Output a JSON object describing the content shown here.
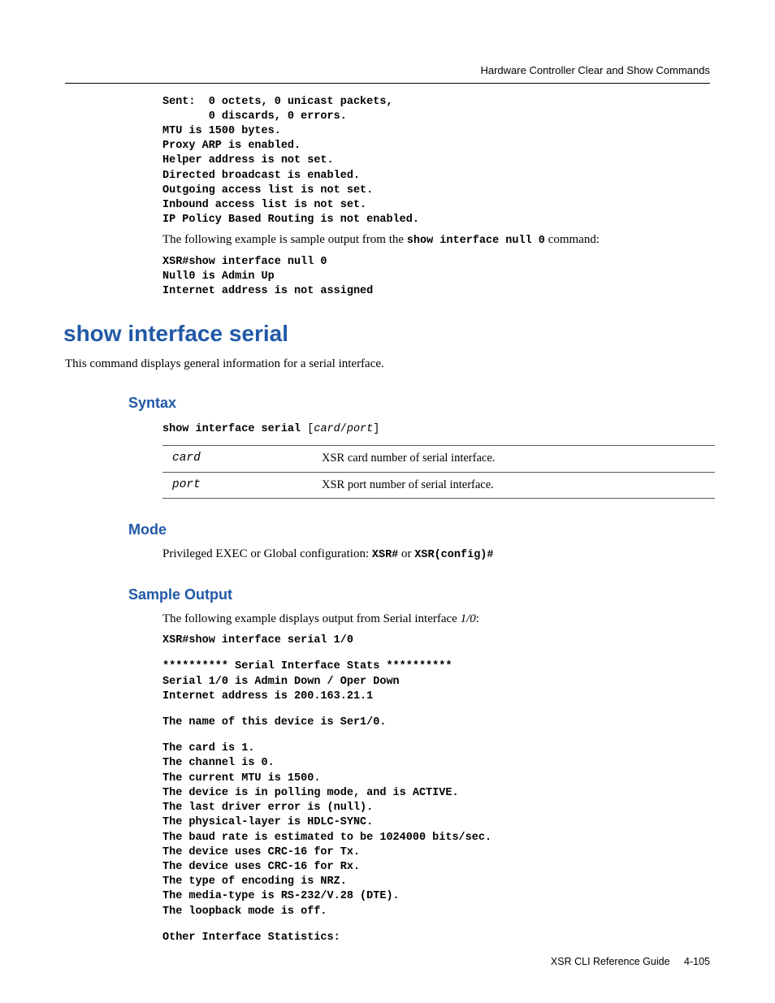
{
  "running_head": "Hardware Controller Clear and Show Commands",
  "top_block": {
    "lines": "Sent:  0 octets, 0 unicast packets,\n       0 discards, 0 errors.\nMTU is 1500 bytes.\nProxy ARP is enabled.\nHelper address is not set.\nDirected broadcast is enabled.\nOutgoing access list is not set.\nInbound access list is not set.\nIP Policy Based Routing is not enabled.",
    "para_lead": "The following example is sample output from the ",
    "para_cmd": "show interface null 0",
    "para_tail": " command:",
    "lines2": "XSR#show interface null 0\nNull0 is Admin Up\nInternet address is not assigned"
  },
  "h1": "show interface serial",
  "h1_desc": "This command displays general information for a serial interface.",
  "syntax": {
    "heading": "Syntax",
    "cmd": "show interface serial ",
    "bracket_open": "[",
    "arg1": "card",
    "slash": "/",
    "arg2": "port",
    "bracket_close": "]",
    "rows": [
      {
        "key": "card",
        "desc": "XSR card number of serial interface."
      },
      {
        "key": "port",
        "desc": "XSR port number of serial interface."
      }
    ]
  },
  "mode": {
    "heading": "Mode",
    "lead": "Privileged EXEC or Global configuration: ",
    "code1": "XSR#",
    "or": " or ",
    "code2": "XSR(config)#"
  },
  "sample": {
    "heading": "Sample Output",
    "para_lead": "The following example displays output from Serial interface ",
    "para_em": "1/0",
    "para_tail": ":",
    "block1": "XSR#show interface serial 1/0",
    "block2": "********** Serial Interface Stats **********\nSerial 1/0 is Admin Down / Oper Down\nInternet address is 200.163.21.1",
    "block3": "The name of this device is Ser1/0.",
    "block4": "The card is 1.\nThe channel is 0.\nThe current MTU is 1500.\nThe device is in polling mode, and is ACTIVE.\nThe last driver error is (null).\nThe physical-layer is HDLC-SYNC.\nThe baud rate is estimated to be 1024000 bits/sec.\nThe device uses CRC-16 for Tx.\nThe device uses CRC-16 for Rx.\nThe type of encoding is NRZ.\nThe media-type is RS-232/V.28 (DTE).\nThe loopback mode is off.",
    "block5": "Other Interface Statistics:"
  },
  "footer": {
    "book": "XSR CLI Reference Guide",
    "page": "4-105"
  }
}
